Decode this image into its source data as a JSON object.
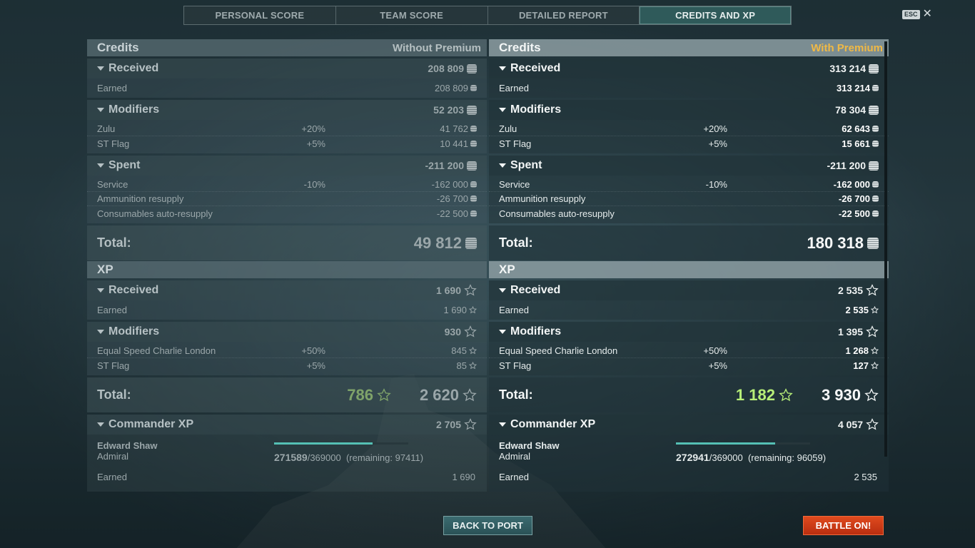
{
  "tabs": [
    {
      "label": "PERSONAL SCORE",
      "active": false
    },
    {
      "label": "TEAM SCORE",
      "active": false
    },
    {
      "label": "DETAILED REPORT",
      "active": false
    },
    {
      "label": "CREDITS AND XP",
      "active": true
    }
  ],
  "esc": {
    "key": "ESC",
    "icon": "close-icon"
  },
  "without_premium": {
    "credits": {
      "title": "Credits",
      "premium_label": "Without Premium",
      "received": {
        "label": "Received",
        "value": "208 809",
        "rows": [
          {
            "label": "Earned",
            "pct": "",
            "value": "208 809"
          }
        ]
      },
      "modifiers": {
        "label": "Modifiers",
        "value": "52 203",
        "rows": [
          {
            "label": "Zulu",
            "pct": "+20%",
            "value": "41 762"
          },
          {
            "label": "ST Flag",
            "pct": "+5%",
            "value": "10 441"
          }
        ]
      },
      "spent": {
        "label": "Spent",
        "value": "-211 200",
        "rows": [
          {
            "label": "Service",
            "pct": "-10%",
            "value": "-162 000"
          },
          {
            "label": "Ammunition resupply",
            "pct": "",
            "value": "-26 700"
          },
          {
            "label": "Consumables auto-resupply",
            "pct": "",
            "value": "-22 500"
          }
        ]
      },
      "total_label": "Total:",
      "total": "49 812"
    },
    "xp": {
      "title": "XP",
      "received": {
        "label": "Received",
        "value": "1 690",
        "rows": [
          {
            "label": "Earned",
            "pct": "",
            "value": "1 690"
          }
        ]
      },
      "modifiers": {
        "label": "Modifiers",
        "value": "930",
        "rows": [
          {
            "label": "Equal Speed Charlie London",
            "pct": "+50%",
            "value": "845"
          },
          {
            "label": "ST Flag",
            "pct": "+5%",
            "value": "85"
          }
        ]
      },
      "total_label": "Total:",
      "total_free": "786",
      "total": "2 620",
      "commander": {
        "label": "Commander XP",
        "value": "2 705",
        "name": "Edward Shaw",
        "rank": "Admiral",
        "current": "271589",
        "max": "/369000",
        "remaining": "(remaining: 97411)",
        "progress": 0.736,
        "earned_label": "Earned",
        "earned_value": "1 690"
      }
    }
  },
  "with_premium": {
    "credits": {
      "title": "Credits",
      "premium_label": "With Premium",
      "received": {
        "label": "Received",
        "value": "313 214",
        "rows": [
          {
            "label": "Earned",
            "pct": "",
            "value": "313 214"
          }
        ]
      },
      "modifiers": {
        "label": "Modifiers",
        "value": "78 304",
        "rows": [
          {
            "label": "Zulu",
            "pct": "+20%",
            "value": "62 643"
          },
          {
            "label": "ST Flag",
            "pct": "+5%",
            "value": "15 661"
          }
        ]
      },
      "spent": {
        "label": "Spent",
        "value": "-211 200",
        "rows": [
          {
            "label": "Service",
            "pct": "-10%",
            "value": "-162 000"
          },
          {
            "label": "Ammunition resupply",
            "pct": "",
            "value": "-26 700"
          },
          {
            "label": "Consumables auto-resupply",
            "pct": "",
            "value": "-22 500"
          }
        ]
      },
      "total_label": "Total:",
      "total": "180 318"
    },
    "xp": {
      "title": "XP",
      "received": {
        "label": "Received",
        "value": "2 535",
        "rows": [
          {
            "label": "Earned",
            "pct": "",
            "value": "2 535"
          }
        ]
      },
      "modifiers": {
        "label": "Modifiers",
        "value": "1 395",
        "rows": [
          {
            "label": "Equal Speed Charlie London",
            "pct": "+50%",
            "value": "1 268"
          },
          {
            "label": "ST Flag",
            "pct": "+5%",
            "value": "127"
          }
        ]
      },
      "total_label": "Total:",
      "total_free": "1 182",
      "total": "3 930",
      "commander": {
        "label": "Commander XP",
        "value": "4 057",
        "name": "Edward Shaw",
        "rank": "Admiral",
        "current": "272941",
        "max": "/369000",
        "remaining": "(remaining: 96059)",
        "progress": 0.74,
        "earned_label": "Earned",
        "earned_value": "2 535"
      }
    }
  },
  "buttons": {
    "back_to_port": "BACK TO PORT",
    "battle_on": "BATTLE ON!"
  },
  "colors": {
    "premium_accent": "#f0b945",
    "free_xp_green": "#b7ef78",
    "battle_button": "#d03a17",
    "active_tab": "#2f5a5a"
  }
}
